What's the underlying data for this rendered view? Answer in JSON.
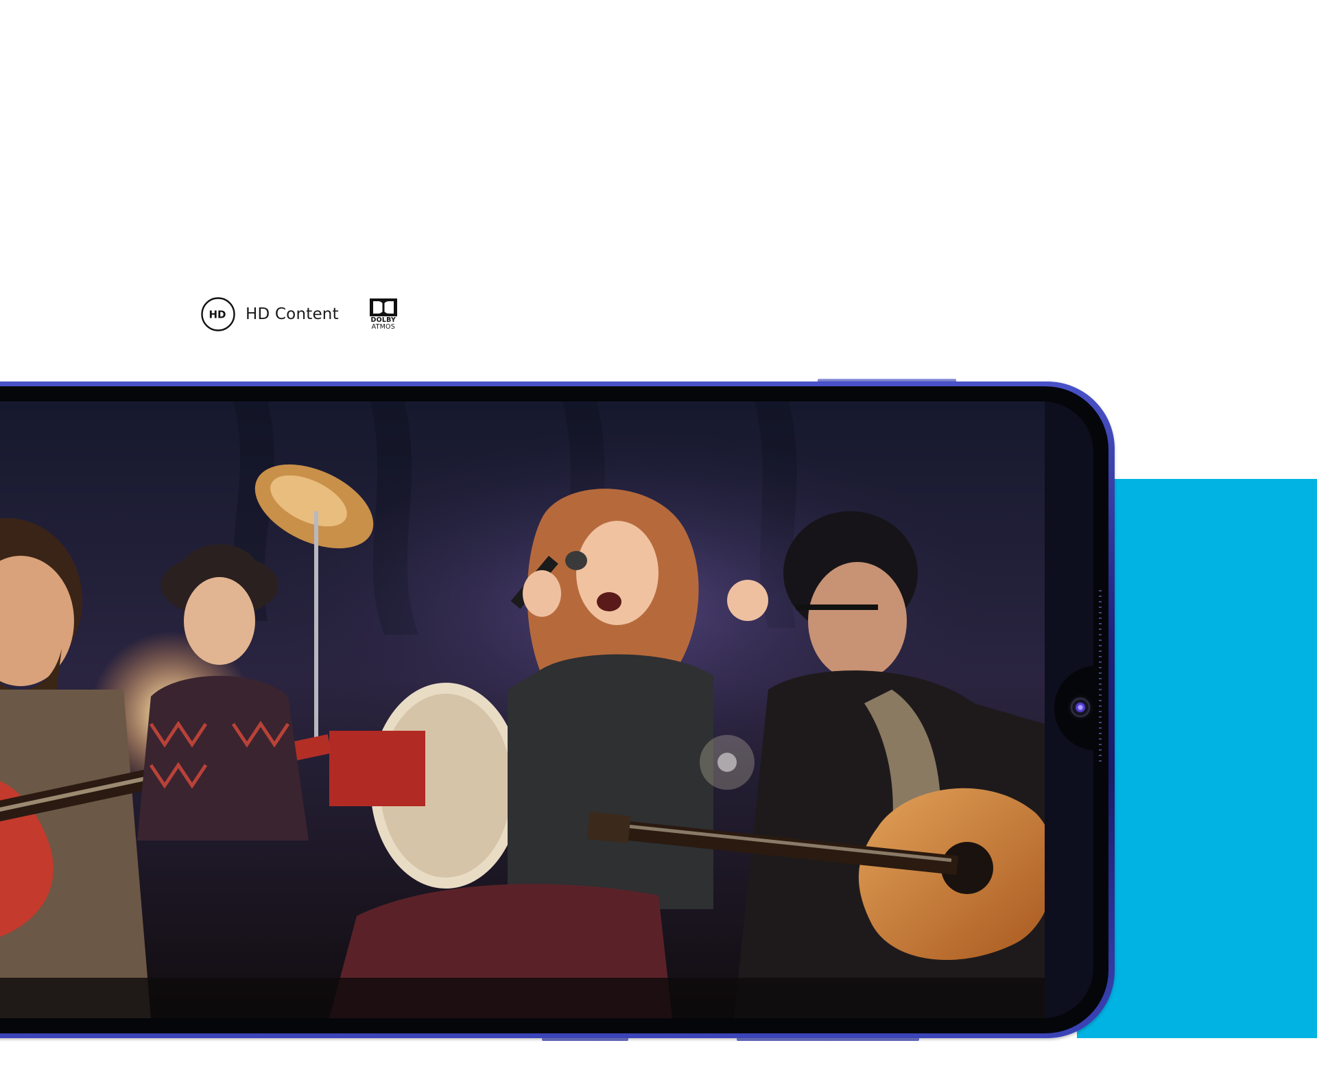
{
  "features": {
    "hd": {
      "icon": "hd-icon",
      "icon_text": "HD",
      "label": "HD Content"
    },
    "dolby": {
      "icon": "dolby-logo",
      "line1": "DOLBY",
      "line2": "ATMOS"
    }
  },
  "phone": {
    "screen_content": "band-performance-photo",
    "camera": "front-camera-icon"
  },
  "colors": {
    "accent": "#00b3e3",
    "phone_frame": "#262a8a",
    "background": "#ffffff"
  }
}
